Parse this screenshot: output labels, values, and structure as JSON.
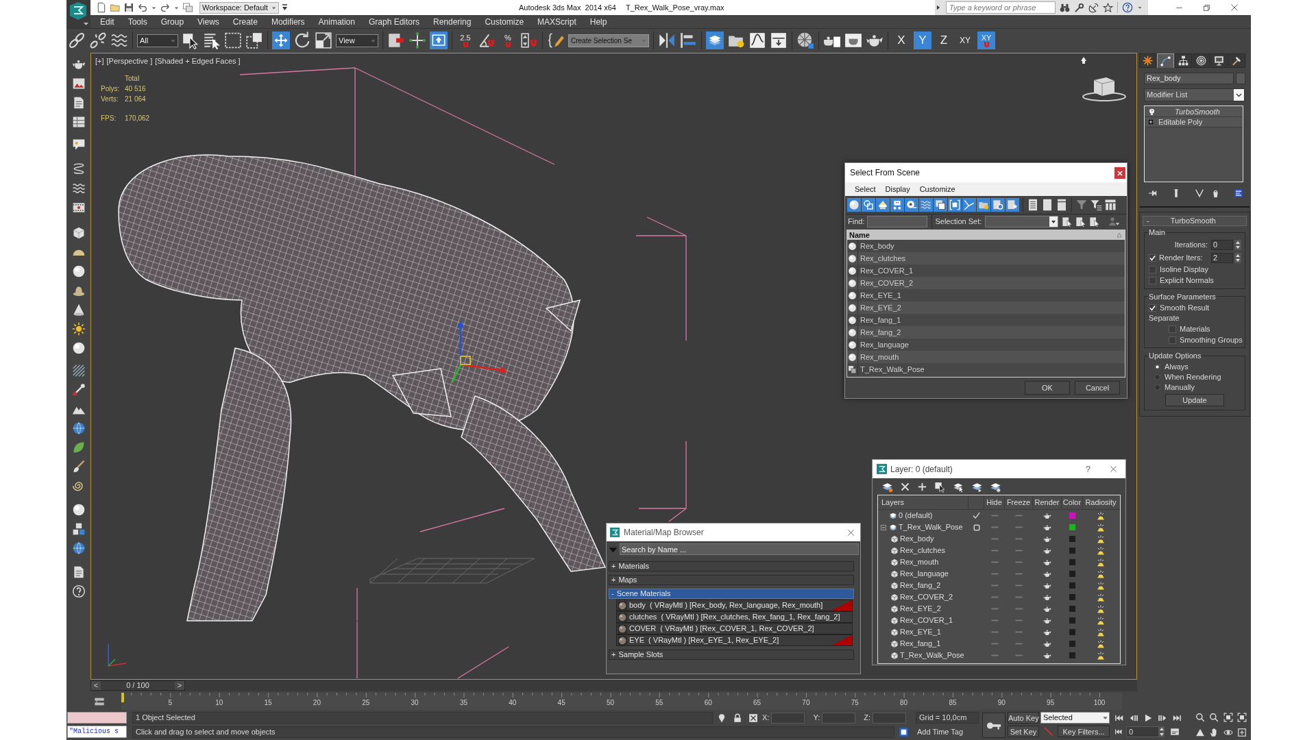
{
  "title_bar": {
    "workspace": "Workspace: Default",
    "app_title": "Autodesk 3ds Max  2014 x64",
    "file_name": "T_Rex_Walk_Pose_vray.max",
    "search": {
      "placeholder": "Type a keyword or phrase"
    }
  },
  "menu_bar": [
    "Edit",
    "Tools",
    "Group",
    "Views",
    "Create",
    "Modifiers",
    "Animation",
    "Graph Editors",
    "Rendering",
    "Customize",
    "MAXScript",
    "Help"
  ],
  "main_toolbar": [
    {
      "kind": "tool",
      "selected": false
    },
    {
      "kind": "tool",
      "selected": false
    },
    {
      "kind": "tool",
      "selected": false
    },
    {
      "kind": "dropdown",
      "value": "All"
    },
    {
      "kind": "tool",
      "selected": false
    },
    {
      "kind": "tool",
      "selected": false
    },
    {
      "kind": "tool",
      "selected": false
    },
    {
      "kind": "tool",
      "selected": false
    },
    {
      "kind": "tool",
      "selected": true
    },
    {
      "kind": "tool",
      "selected": false
    },
    {
      "kind": "tool",
      "selected": false
    },
    {
      "kind": "dropdown",
      "value": "View"
    },
    {
      "kind": "tool",
      "selected": false
    },
    {
      "kind": "tool",
      "selected": false
    },
    {
      "kind": "tool",
      "selected": true
    },
    {
      "kind": "snap",
      "label": "2.5",
      "selected": false
    },
    {
      "kind": "tool",
      "selected": false
    },
    {
      "kind": "snap",
      "label": "%",
      "selected": false
    },
    {
      "kind": "tool",
      "selected": false
    },
    {
      "kind": "tool",
      "selected": false
    },
    {
      "kind": "dropdown",
      "value": "Create Selection Se"
    },
    {
      "kind": "tool",
      "selected": false
    },
    {
      "kind": "tool",
      "selected": false
    },
    {
      "kind": "tool",
      "selected": true
    },
    {
      "kind": "tool",
      "selected": false
    },
    {
      "kind": "tool",
      "selected": false
    },
    {
      "kind": "tool",
      "selected": false
    },
    {
      "kind": "tool",
      "selected": false
    },
    {
      "kind": "tool",
      "selected": false
    },
    {
      "kind": "tool",
      "selected": false
    },
    {
      "kind": "tool",
      "selected": false
    },
    {
      "kind": "axis",
      "label": "X",
      "selected": false
    },
    {
      "kind": "axis",
      "label": "Y",
      "selected": true
    },
    {
      "kind": "axis",
      "label": "Z",
      "selected": false
    },
    {
      "kind": "axis",
      "label": "XY",
      "selected": false
    },
    {
      "kind": "axis_snap",
      "label": "XY",
      "selected": true
    }
  ],
  "viewport": {
    "labels": [
      "[+]",
      "[Perspective ]",
      "[Shaded + Edged Faces ]"
    ],
    "stats": {
      "heading": "Total",
      "rows": [
        {
          "label": "Polys:",
          "value": "40 516"
        },
        {
          "label": "Verts:",
          "value": "21 064"
        }
      ],
      "fps": {
        "label": "FPS:",
        "value": "170,062"
      }
    }
  },
  "select_from_scene": {
    "title": "Select From Scene",
    "menu": [
      "Select",
      "Display",
      "Customize"
    ],
    "filters": [
      {
        "selected": true
      },
      {
        "selected": true
      },
      {
        "selected": true
      },
      {
        "selected": true
      },
      {
        "selected": true
      },
      {
        "selected": true
      },
      {
        "selected": true
      },
      {
        "selected": true
      },
      {
        "selected": true
      },
      {
        "selected": true
      },
      {
        "selected": true
      },
      {
        "selected": true
      }
    ],
    "find_label": "Find:",
    "selection_set_label": "Selection Set:",
    "column": "Name",
    "rows": [
      {
        "name": "Rex_body",
        "kind": "geometry",
        "selected": false
      },
      {
        "name": "Rex_clutches",
        "kind": "geometry",
        "selected": false
      },
      {
        "name": "Rex_COVER_1",
        "kind": "geometry",
        "selected": false
      },
      {
        "name": "Rex_COVER_2",
        "kind": "geometry",
        "selected": false
      },
      {
        "name": "Rex_EYE_1",
        "kind": "geometry",
        "selected": false
      },
      {
        "name": "Rex_EYE_2",
        "kind": "geometry",
        "selected": false
      },
      {
        "name": "Rex_fang_1",
        "kind": "geometry",
        "selected": false
      },
      {
        "name": "Rex_fang_2",
        "kind": "geometry",
        "selected": false
      },
      {
        "name": "Rex_language",
        "kind": "geometry",
        "selected": false
      },
      {
        "name": "Rex_mouth",
        "kind": "geometry",
        "selected": false
      },
      {
        "name": "T_Rex_Walk_Pose",
        "kind": "group",
        "selected": false
      }
    ],
    "buttons": [
      "OK",
      "Cancel"
    ]
  },
  "layer_manager": {
    "title": "Layer: 0 (default)",
    "help": "?",
    "columns": [
      "Layers",
      "Hide",
      "Freeze",
      "Render",
      "Color",
      "Radiosity"
    ],
    "layers": [
      {
        "name": "0 (default)",
        "kind": "layer",
        "current": true,
        "hidden": false,
        "frozen": false,
        "renderable": true,
        "radiosity": true,
        "color": "#c418b4",
        "selected": false
      },
      {
        "name": "T_Rex_Walk_Pose",
        "kind": "layer",
        "current": false,
        "expanded": true,
        "hidden": false,
        "frozen": false,
        "renderable": true,
        "radiosity": true,
        "color": "#1cb41c",
        "selected": false,
        "children": [
          {
            "name": "Rex_body",
            "kind": "object",
            "hidden": false,
            "frozen": false,
            "renderable": true,
            "radiosity": true,
            "color": "#1e1e1e",
            "selected": false
          },
          {
            "name": "Rex_clutches",
            "kind": "object",
            "hidden": false,
            "frozen": false,
            "renderable": true,
            "radiosity": true,
            "color": "#1e1e1e",
            "selected": false
          },
          {
            "name": "Rex_mouth",
            "kind": "object",
            "hidden": false,
            "frozen": false,
            "renderable": true,
            "radiosity": true,
            "color": "#1e1e1e",
            "selected": false
          },
          {
            "name": "Rex_language",
            "kind": "object",
            "hidden": false,
            "frozen": false,
            "renderable": true,
            "radiosity": true,
            "color": "#1e1e1e",
            "selected": false
          },
          {
            "name": "Rex_fang_2",
            "kind": "object",
            "hidden": false,
            "frozen": false,
            "renderable": true,
            "radiosity": true,
            "color": "#1e1e1e",
            "selected": false
          },
          {
            "name": "Rex_COVER_2",
            "kind": "object",
            "hidden": false,
            "frozen": false,
            "renderable": true,
            "radiosity": true,
            "color": "#1e1e1e",
            "selected": false
          },
          {
            "name": "Rex_EYE_2",
            "kind": "object",
            "hidden": false,
            "frozen": false,
            "renderable": true,
            "radiosity": true,
            "color": "#1e1e1e",
            "selected": false
          },
          {
            "name": "Rex_COVER_1",
            "kind": "object",
            "hidden": false,
            "frozen": false,
            "renderable": true,
            "radiosity": true,
            "color": "#1e1e1e",
            "selected": false
          },
          {
            "name": "Rex_EYE_1",
            "kind": "object",
            "hidden": false,
            "frozen": false,
            "renderable": true,
            "radiosity": true,
            "color": "#1e1e1e",
            "selected": false
          },
          {
            "name": "Rex_fang_1",
            "kind": "object",
            "hidden": false,
            "frozen": false,
            "renderable": true,
            "radiosity": true,
            "color": "#1e1e1e",
            "selected": false
          },
          {
            "name": "T_Rex_Walk_Pose",
            "kind": "object",
            "hidden": false,
            "frozen": false,
            "renderable": true,
            "radiosity": true,
            "color": "#1e1e1e",
            "selected": false
          }
        ]
      }
    ]
  },
  "material_browser": {
    "title": "Material/Map Browser",
    "search": {
      "placeholder": "Search by Name ..."
    },
    "sections": [
      {
        "sign": "+",
        "label": "Materials",
        "expanded": false
      },
      {
        "sign": "+",
        "label": "Maps",
        "expanded": false
      },
      {
        "sign": "-",
        "label": "Scene Materials",
        "expanded": true,
        "items": [
          {
            "label": "body  ( VRayMtl ) [Rex_body, Rex_language, Rex_mouth]",
            "in_viewport": true
          },
          {
            "label": "clutches  ( VRayMtl ) [Rex_clutches, Rex_fang_1, Rex_fang_2]",
            "in_viewport": false
          },
          {
            "label": "COVER  ( VRayMtl ) [Rex_COVER_1, Rex_COVER_2]",
            "in_viewport": false
          },
          {
            "label": "EYE  ( VRayMtl ) [Rex_EYE_1, Rex_EYE_2]",
            "in_viewport": true
          }
        ]
      },
      {
        "sign": "+",
        "label": "Sample Slots",
        "expanded": false
      }
    ]
  },
  "command_panel": {
    "tabs": [
      {
        "selected": false
      },
      {
        "selected": true
      },
      {
        "selected": false
      },
      {
        "selected": false
      },
      {
        "selected": false
      },
      {
        "selected": false
      }
    ],
    "object_name": "Rex_body",
    "modifier_list": "Modifier List",
    "stack": [
      {
        "label": "TurboSmooth",
        "kind": "modifier"
      },
      {
        "label": "Editable Poly",
        "kind": "base_object"
      }
    ],
    "rollout": {
      "sign": "-",
      "title": "TurboSmooth",
      "groups": [
        {
          "title": "Main",
          "controls": [
            {
              "kind": "spinner",
              "label": "Iterations:",
              "value": "0"
            },
            {
              "kind": "check_spinner",
              "label": "Render Iters:",
              "value": "2",
              "checked": true
            },
            {
              "kind": "checkbox",
              "label": "Isoline Display",
              "checked": false
            },
            {
              "kind": "checkbox",
              "label": "Explicit Normals",
              "checked": false
            }
          ]
        },
        {
          "title": "Surface Parameters",
          "controls": [
            {
              "kind": "checkbox",
              "label": "Smooth Result",
              "checked": true
            },
            {
              "kind": "heading",
              "label": "Separate",
              "children": [
                {
                  "kind": "checkbox",
                  "label": "Materials",
                  "checked": false
                },
                {
                  "kind": "checkbox",
                  "label": "Smoothing Groups",
                  "checked": false
                }
              ]
            }
          ]
        },
        {
          "title": "Update Options",
          "controls": [
            {
              "kind": "radio",
              "label": "Always",
              "selected": true
            },
            {
              "kind": "radio",
              "label": "When Rendering",
              "selected": false
            },
            {
              "kind": "radio",
              "label": "Manually",
              "selected": false
            },
            {
              "kind": "button",
              "label": "Update"
            }
          ]
        }
      ]
    }
  },
  "time_slider": {
    "prev": "<",
    "position": "0 / 100",
    "next": ">",
    "level": 0
  },
  "track_bar": {
    "ticks": [
      "5",
      "10",
      "15",
      "20",
      "25",
      "30",
      "35",
      "40",
      "45",
      "50",
      "55",
      "60",
      "65",
      "70",
      "75",
      "80",
      "85",
      "90",
      "95",
      "100"
    ]
  },
  "status_bar": {
    "script_text": "\"Malicious s",
    "selection": "1 Object Selected",
    "prompt": "Click and drag to select and move objects",
    "coords": [
      "X:",
      "Y:",
      "Z:"
    ],
    "grid": "Grid = 10,0cm",
    "time_tag": "Add Time Tag",
    "auto_key": {
      "label": "Auto Key",
      "on": false
    },
    "set_key": "Set Key",
    "key_mode": "Selected",
    "key_filters": "Key Filters...",
    "frame": "0"
  }
}
